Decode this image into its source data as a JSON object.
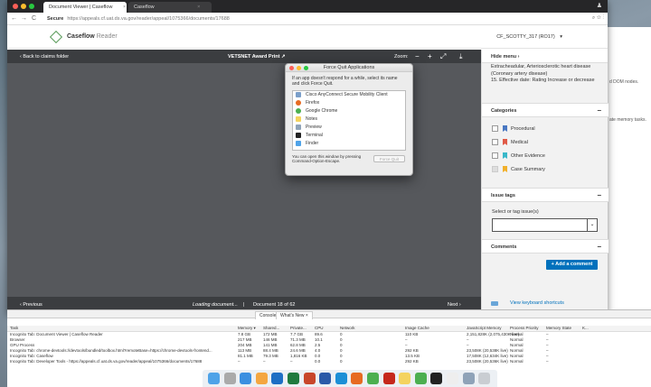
{
  "browser": {
    "tabs": [
      {
        "label": "Document Viewer | Caseflow",
        "close": "×"
      },
      {
        "label": "Caseflow",
        "close": "×"
      }
    ],
    "secure_label": "Secure",
    "url": "https://appeals.cf.uat.ds.va.gov/reader/appeal/1075366/documents/17688",
    "back": "←",
    "forward": "→",
    "reload": "C",
    "zoom_icon": "⌕",
    "star_icon": "☆",
    "menu_icon": "⋮",
    "profile_icon": "♟"
  },
  "app": {
    "brand_bold": "Caseflow",
    "brand_sub": "Reader",
    "user": "CF_SCOTTY_317 (RO17)",
    "user_chevron": "▾"
  },
  "viewer": {
    "back_label": "Back to claims folder",
    "doc_title": "VETSNET Award Print",
    "zoom_label": "Zoom:",
    "zoom_out": "−",
    "zoom_in": "+",
    "fit": "⤢",
    "download": "⤓",
    "previous": "Previous",
    "loading": "Loading document...",
    "separator": "|",
    "doc_count": "Document 18 of 62",
    "next": "Next"
  },
  "sidebar": {
    "hide_menu": "Hide menu",
    "hide_chevron": "›",
    "issue_text_1": "Extracheadular, Arteriosclerotic heart disease (Coronary artery disease)",
    "issue_text_2": "15. Effective date: Rating Increase or decrease",
    "categories_title": "Categories",
    "categories": [
      {
        "label": "Procedural",
        "color": "#4a78c2",
        "checked_disabled": false
      },
      {
        "label": "Medical",
        "color": "#e05a47",
        "checked_disabled": false
      },
      {
        "label": "Other Evidence",
        "color": "#3ab8c9",
        "checked_disabled": false
      },
      {
        "label": "Case Summary",
        "color": "#f1b02b",
        "checked_disabled": true
      }
    ],
    "issue_tags_title": "Issue tags",
    "select_label": "Select or tag issue(s)",
    "select_arrow": "⌄",
    "comments_title": "Comments",
    "add_comment": "+ Add a comment",
    "shortcuts": "View keyboard shortcuts",
    "minimize": "−"
  },
  "force_quit": {
    "title": "Force Quit Applications",
    "message": "If an app doesn't respond for a while, select its name and click Force Quit.",
    "apps": [
      {
        "name": "Cisco AnyConnect Secure Mobility Client",
        "color": "#7a9ec9"
      },
      {
        "name": "Firefox",
        "color": "#e76b22"
      },
      {
        "name": "Google Chrome",
        "color": "#4caf50"
      },
      {
        "name": "Notes",
        "color": "#f4d35e"
      },
      {
        "name": "Preview",
        "color": "#8fa3b8"
      },
      {
        "name": "Terminal",
        "color": "#222222"
      },
      {
        "name": "Finder",
        "color": "#4fa3e8"
      }
    ],
    "footer": "You can open this window by pressing Command-Option-Escape.",
    "button": "Force Quit"
  },
  "devtools": {
    "tabs": [
      "Console",
      "What's New ×"
    ],
    "columns": [
      "Task",
      "Memory ▾",
      "Shared...",
      "Private...",
      "CPU",
      "Network",
      "Image Cache",
      "JavaScript Memory",
      "Process Priority",
      "Memory State",
      "K..."
    ],
    "rows": [
      [
        "Incognito Tab: Document Viewer | Caseflow Reader",
        "7.8 GB",
        "172 MB",
        "7.7 GB",
        "89.6",
        "0",
        "110 KB",
        "2,151,828K (2,075,430K live)",
        "Normal",
        "–"
      ],
      [
        "Browser",
        "217 MB",
        "146 MB",
        "71.3 MB",
        "10.1",
        "0",
        "–",
        "–",
        "Normal",
        "–"
      ],
      [
        "GPU Process",
        "204 MB",
        "141 MB",
        "62.8 MB",
        "2.5",
        "0",
        "–",
        "–",
        "Normal",
        "–"
      ],
      [
        "Incognito Tab: chrome-devtools://devtools/bundled/toolbox.html?remoteBase=https://chrome-devtools-frontend...",
        "113 MB",
        "88.4 MB",
        "24.6 MB",
        "4.0",
        "0",
        "292 KB",
        "23,508K (20,538K live)",
        "Normal",
        "–"
      ],
      [
        "Incognito Tab: Caseflow",
        "81.1 MB",
        "79.3 MB",
        "1,816 KB",
        "0.0",
        "0",
        "13.5 KB",
        "17,508K (12,634K live)",
        "Normal",
        "–"
      ],
      [
        "Incognito Tab: Developer Tools - https://appeals.cf.uat.ds.va.gov/reader/appeal/1075366/documents/17688",
        "–",
        "–",
        "–",
        "0.0",
        "0",
        "292 KB",
        "23,508K (20,536K live)",
        "Normal",
        "–"
      ]
    ]
  },
  "background_window": {
    "text_1": "d DOM nodes.",
    "text_2": "ate memory tasks."
  },
  "dock": {
    "icons": [
      "finder-icon",
      "launchpad-icon",
      "safari-icon",
      "photos-icon",
      "outlook-icon",
      "excel-icon",
      "powerpoint-icon",
      "word-icon",
      "lync-icon",
      "firefox-icon",
      "chrome-icon",
      "acrobat-icon",
      "notes-icon",
      "chrome-2-icon",
      "terminal-icon",
      "notes-2-icon",
      "preview-icon",
      "trash-icon"
    ],
    "colors": [
      "#4fa3e8",
      "#aaaaaa",
      "#3b8fe0",
      "#f4a640",
      "#1e6fc4",
      "#1f7a3e",
      "#c8462a",
      "#2b5aa8",
      "#1c8fd6",
      "#e76b22",
      "#4caf50",
      "#c5281c",
      "#f4d35e",
      "#4caf50",
      "#222222",
      "#eeeeee",
      "#8fa3b8",
      "#c9cdd2"
    ]
  }
}
